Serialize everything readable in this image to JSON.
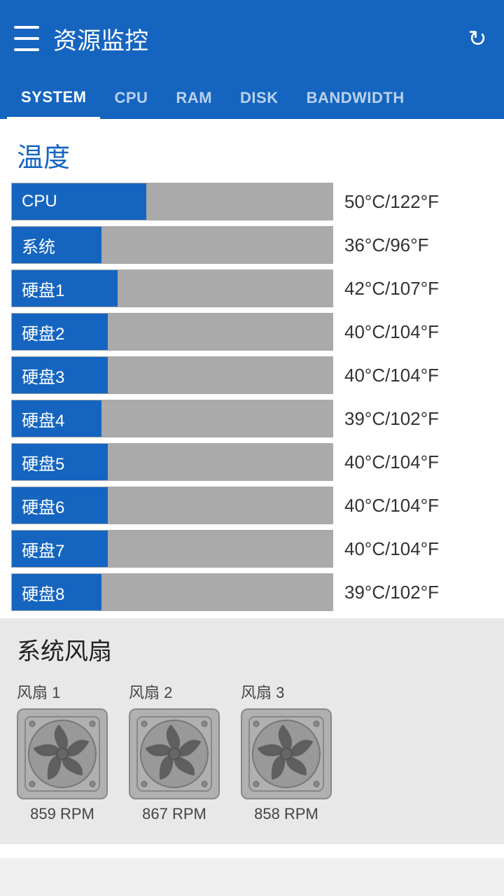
{
  "header": {
    "title": "资源监控",
    "menu_icon": "menu-icon",
    "refresh_icon": "↻"
  },
  "tabs": [
    {
      "label": "SYSTEM",
      "active": true
    },
    {
      "label": "CPU",
      "active": false
    },
    {
      "label": "RAM",
      "active": false
    },
    {
      "label": "DISK",
      "active": false
    },
    {
      "label": "BANDWIDTH",
      "active": false
    }
  ],
  "temperature_section": {
    "title": "温度",
    "rows": [
      {
        "name": "CPU",
        "fill_pct": 42,
        "value": "50°C/122°F"
      },
      {
        "name": "系统",
        "fill_pct": 28,
        "value": "36°C/96°F"
      },
      {
        "name": "硬盘1",
        "fill_pct": 33,
        "value": "42°C/107°F"
      },
      {
        "name": "硬盘2",
        "fill_pct": 30,
        "value": "40°C/104°F"
      },
      {
        "name": "硬盘3",
        "fill_pct": 30,
        "value": "40°C/104°F"
      },
      {
        "name": "硬盘4",
        "fill_pct": 28,
        "value": "39°C/102°F"
      },
      {
        "name": "硬盘5",
        "fill_pct": 30,
        "value": "40°C/104°F"
      },
      {
        "name": "硬盘6",
        "fill_pct": 30,
        "value": "40°C/104°F"
      },
      {
        "name": "硬盘7",
        "fill_pct": 30,
        "value": "40°C/104°F"
      },
      {
        "name": "硬盘8",
        "fill_pct": 28,
        "value": "39°C/102°F"
      }
    ]
  },
  "fan_section": {
    "title": "系统风扇",
    "fans": [
      {
        "label": "风扇 1",
        "rpm": "859 RPM"
      },
      {
        "label": "风扇 2",
        "rpm": "867 RPM"
      },
      {
        "label": "风扇 3",
        "rpm": "858 RPM"
      }
    ]
  }
}
